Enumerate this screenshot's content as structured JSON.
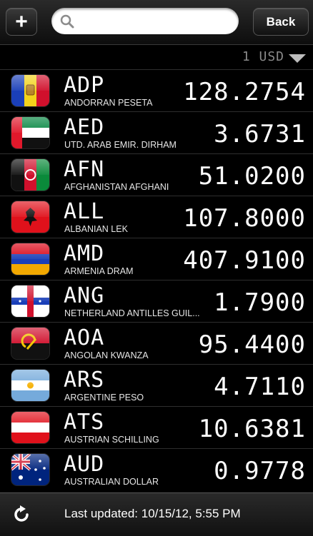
{
  "toolbar": {
    "add_label": "+",
    "back_label": "Back",
    "search": {
      "value": "",
      "placeholder": ""
    }
  },
  "base": {
    "label": "1 USD"
  },
  "currencies": [
    {
      "code": "ADP",
      "name": "ANDORRAN PESETA",
      "value": "128.2754",
      "flag": "andorra-flag-icon"
    },
    {
      "code": "AED",
      "name": "UTD. ARAB EMIR. DIRHAM",
      "value": "3.6731",
      "flag": "uae-flag-icon"
    },
    {
      "code": "AFN",
      "name": "AFGHANISTAN AFGHANI",
      "value": "51.0200",
      "flag": "afghanistan-flag-icon"
    },
    {
      "code": "ALL",
      "name": "ALBANIAN LEK",
      "value": "107.8000",
      "flag": "albania-flag-icon"
    },
    {
      "code": "AMD",
      "name": "ARMENIA DRAM",
      "value": "407.9100",
      "flag": "armenia-flag-icon"
    },
    {
      "code": "ANG",
      "name": "NETHERLAND ANTILLES GUIL...",
      "value": "1.7900",
      "flag": "netherlands-antilles-flag-icon"
    },
    {
      "code": "AOA",
      "name": "ANGOLAN KWANZA",
      "value": "95.4400",
      "flag": "angola-flag-icon"
    },
    {
      "code": "ARS",
      "name": "ARGENTINE PESO",
      "value": "4.7110",
      "flag": "argentina-flag-icon"
    },
    {
      "code": "ATS",
      "name": "AUSTRIAN SCHILLING",
      "value": "10.6381",
      "flag": "austria-flag-icon"
    },
    {
      "code": "AUD",
      "name": "AUSTRALIAN DOLLAR",
      "value": "0.9778",
      "flag": "australia-flag-icon"
    }
  ],
  "footer": {
    "updated_text": "Last updated: 10/15/12, 5:55 PM"
  },
  "icons": {
    "add": "plus-icon",
    "search": "search-icon",
    "dropdown": "caret-down-icon",
    "refresh": "refresh-icon"
  }
}
